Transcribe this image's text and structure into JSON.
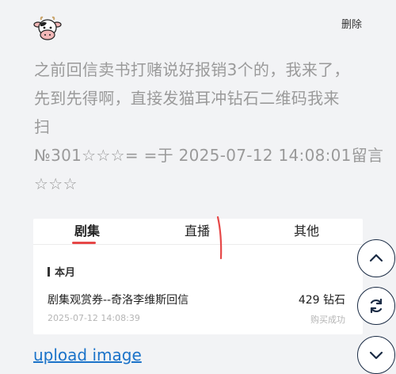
{
  "header": {
    "delete_label": "删除",
    "avatar_icon": "cow-avatar-icon"
  },
  "message": {
    "lines": [
      "之前回信卖书打赌说好报销3个的，我来了，",
      "先到先得啊，直接发猫耳冲钻石二维码我来",
      "扫",
      "№301☆☆☆= =于 2025-07-12 14:08:01留言",
      "☆☆☆"
    ]
  },
  "card": {
    "tabs": [
      {
        "label": "剧集",
        "active": true
      },
      {
        "label": "直播",
        "active": false
      },
      {
        "label": "其他",
        "active": false
      }
    ],
    "month_label": "本月",
    "record": {
      "title": "剧集观赏券--奇洛李维斯回信",
      "amount": "429 钻石",
      "date": "2025-07-12 14:08:39",
      "status": "购买成功"
    }
  },
  "upload_link": "upload image",
  "side_buttons": [
    {
      "icon": "chevron-up-icon"
    },
    {
      "icon": "refresh-icon"
    },
    {
      "icon": "chevron-down-icon"
    }
  ],
  "colors": {
    "accent": "#e64848",
    "link": "#1b73c9",
    "fab_border": "#1a2b44"
  }
}
